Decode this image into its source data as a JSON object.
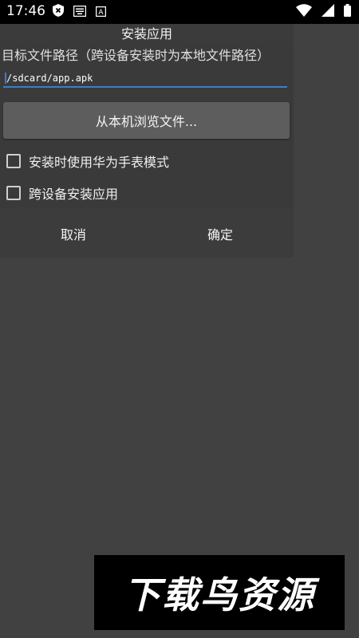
{
  "status_bar": {
    "time": "17:46",
    "left_icons": [
      "shield-x-icon",
      "notification-list-icon",
      "font-a-icon"
    ],
    "right_icons": [
      "wifi-icon",
      "signal-icon",
      "battery-icon"
    ],
    "font_icon_label": "A"
  },
  "dialog": {
    "title": "安装应用",
    "subtitle": "目标文件路径（跨设备安装时为本地文件路径）",
    "path_value": "/sdcard/app.apk",
    "browse_label": "从本机浏览文件...",
    "checkboxes": [
      {
        "label": "安装时使用华为手表模式",
        "checked": false
      },
      {
        "label": "跨设备安装应用",
        "checked": false
      }
    ],
    "cancel_label": "取消",
    "ok_label": "确定"
  },
  "watermark": {
    "text": "下载鸟资源"
  },
  "colors": {
    "accent": "#3a7ec9",
    "background": "#414141",
    "dialog": "#3a3a3a"
  }
}
